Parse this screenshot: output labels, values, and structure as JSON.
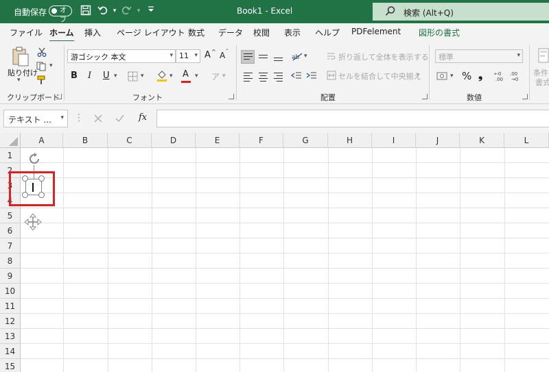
{
  "titlebar": {
    "autosave_label": "自動保存",
    "autosave_state": "オフ",
    "document_title": "Book1  -  Excel",
    "search_text": "検索 (Alt+Q)",
    "icons": [
      "save-icon",
      "undo-icon",
      "redo-icon",
      "customize-icon"
    ]
  },
  "tabs": [
    "ファイル",
    "ホーム",
    "挿入",
    "ページ レイアウト",
    "数式",
    "データ",
    "校閲",
    "表示",
    "ヘルプ",
    "PDFelement",
    "図形の書式"
  ],
  "ribbon": {
    "clipboard": {
      "paste_label": "貼り付け",
      "group_label": "クリップボード"
    },
    "font": {
      "font_name": "游ゴシック 本文",
      "font_size": "11",
      "bold": "B",
      "italic": "I",
      "underline": "U",
      "group_label": "フォント",
      "grow_label": "A",
      "shrink_label": "A",
      "font_color_label": "A"
    },
    "alignment": {
      "wrap_text_label": "折り返して全体を表示する",
      "merge_center_label": "セルを結合して中央揃え",
      "group_label": "配置"
    },
    "number": {
      "format_value": "標準",
      "percent_label": "%",
      "comma_label": "❟",
      "group_label": "数値"
    },
    "styles": {
      "conditional_label": "条件",
      "format_label": "書式"
    }
  },
  "formula_bar": {
    "name_box": "テキスト ...",
    "fx_label": "fx",
    "formula": ""
  },
  "sheet": {
    "columns": [
      "A",
      "B",
      "C",
      "D",
      "E",
      "F",
      "G",
      "H",
      "I",
      "J",
      "K",
      "L"
    ],
    "rows": [
      "1",
      "2",
      "3",
      "4",
      "5",
      "6",
      "7",
      "8",
      "9",
      "10",
      "11",
      "12",
      "13",
      "14",
      "15"
    ]
  },
  "colors": {
    "accent": "#217346",
    "highlight": "#e02020",
    "fill_color": "#f7c400",
    "font_color": "#e02020"
  }
}
